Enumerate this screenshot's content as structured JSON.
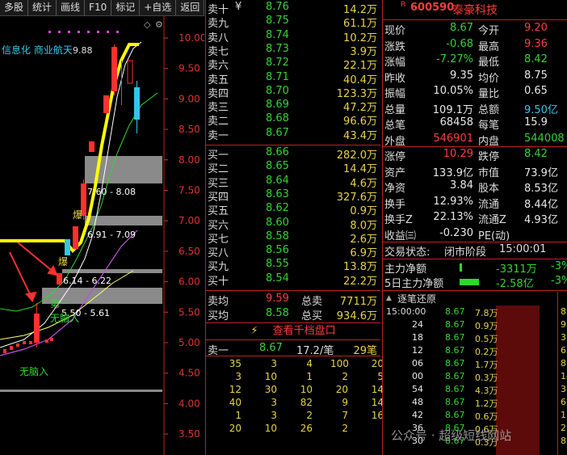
{
  "toolbar": [
    "多股",
    "统计",
    "画线",
    "F10",
    "标记",
    "+自选",
    "返回"
  ],
  "chart": {
    "axis_ticks": [
      "10.00",
      "9.50",
      "9.00",
      "8.50",
      "8.00",
      "7.50",
      "7.00",
      "6.50",
      "6.00",
      "5.50",
      "5.00",
      "4.50",
      "4.00",
      "3.50"
    ],
    "tag_text": "信息化 商业航天",
    "annotations": {
      "high": "9.88",
      "zone1": "7.60 - 8.08",
      "zone2": "6.91 - 7.09",
      "zone3": "6.14 - 6.22",
      "zone4": "5.50 - 5.61",
      "explode": "爆",
      "n1": "第一",
      "n2": "无脑入",
      "n3": "无脑入"
    },
    "colors": {
      "up": "#ff3030",
      "down": "#30c8e8",
      "ma_yellow": "#ffff00",
      "ma_white": "#ffffff",
      "ma_green": "#2ed82e",
      "ma_magenta": "#c050e0"
    }
  },
  "book": {
    "sell": [
      {
        "label": "卖十",
        "price": "8.76",
        "vol": "14.2万"
      },
      {
        "label": "卖九",
        "price": "8.75",
        "vol": "61.1万"
      },
      {
        "label": "卖八",
        "price": "8.74",
        "vol": "10.2万"
      },
      {
        "label": "卖七",
        "price": "8.73",
        "vol": "3.9万"
      },
      {
        "label": "卖六",
        "price": "8.72",
        "vol": "22.1万"
      },
      {
        "label": "卖五",
        "price": "8.71",
        "vol": "40.4万"
      },
      {
        "label": "卖四",
        "price": "8.70",
        "vol": "123.3万"
      },
      {
        "label": "卖三",
        "price": "8.69",
        "vol": "47.2万"
      },
      {
        "label": "卖二",
        "price": "8.68",
        "vol": "96.6万"
      },
      {
        "label": "卖一",
        "price": "8.67",
        "vol": "43.4万"
      }
    ],
    "sell_top_marks": "¥",
    "buy": [
      {
        "label": "买一",
        "price": "8.66",
        "vol": "282.0万"
      },
      {
        "label": "买二",
        "price": "8.65",
        "vol": "14.4万"
      },
      {
        "label": "买三",
        "price": "8.64",
        "vol": "4.6万"
      },
      {
        "label": "买四",
        "price": "8.63",
        "vol": "327.6万"
      },
      {
        "label": "买五",
        "price": "8.62",
        "vol": "0.9万"
      },
      {
        "label": "买六",
        "price": "8.60",
        "vol": "8.0万"
      },
      {
        "label": "买七",
        "price": "8.58",
        "vol": "2.6万"
      },
      {
        "label": "买八",
        "price": "8.56",
        "vol": "6.9万"
      },
      {
        "label": "买九",
        "price": "8.55",
        "vol": "13.8万"
      },
      {
        "label": "买十",
        "price": "8.54",
        "vol": "22.2万"
      }
    ],
    "avg_sell": {
      "label": "卖均",
      "price": "9.59",
      "total_label": "总卖",
      "total": "7711万"
    },
    "avg_buy": {
      "label": "买均",
      "price": "8.58",
      "total_label": "总买",
      "total": "934.6万"
    },
    "view_button": "查看千档盘口",
    "sell1_detail": {
      "label": "卖一",
      "price": "8.67",
      "avg": "17.2/笔",
      "count": "29笔"
    },
    "queue": [
      [
        "35",
        "3",
        "4",
        "100",
        "20"
      ],
      [
        "3",
        "10",
        "1",
        "2",
        "5"
      ],
      [
        "12",
        "30",
        "10",
        "20",
        "14"
      ],
      [
        "40",
        "3",
        "82",
        "9",
        "14"
      ],
      [
        "1",
        "3",
        "2",
        "7",
        "16"
      ],
      [
        "20",
        "10",
        "26",
        "2",
        ""
      ]
    ]
  },
  "info": {
    "code": "600590",
    "name": "泰豪科技",
    "rows": [
      {
        "a": "现价",
        "av": "8.67",
        "b": "今开",
        "bv": "9.20"
      },
      {
        "a": "涨跌",
        "av": "-0.68",
        "b": "最高",
        "bv": "9.36"
      },
      {
        "a": "涨幅",
        "av": "-7.27%",
        "b": "最低",
        "bv": "8.42"
      },
      {
        "a": "昨收",
        "av": "9.35",
        "b": "均价",
        "bv": "8.75"
      },
      {
        "a": "振幅",
        "av": "10.05%",
        "b": "量比",
        "bv": "0.65"
      },
      {
        "a": "总量",
        "av": "109.1万",
        "b": "总额",
        "bv": "9.50亿"
      },
      {
        "a": "总笔",
        "av": "68458",
        "b": "每笔",
        "bv": "15.9"
      },
      {
        "a": "外盘",
        "av": "546901",
        "b": "内盘",
        "bv": "544008"
      }
    ],
    "rows2": [
      {
        "a": "涨停",
        "av": "10.29",
        "b": "跌停",
        "bv": "8.42"
      },
      {
        "a": "资产",
        "av": "133.9亿",
        "b": "市值",
        "bv": "73.9亿"
      },
      {
        "a": "净资",
        "av": "3.84",
        "b": "股本",
        "bv": "8.53亿"
      },
      {
        "a": "换手",
        "av": "12.93%",
        "b": "流通",
        "bv": "8.44亿"
      },
      {
        "a": "换手Z",
        "av": "22.13%",
        "b": "流通Z",
        "bv": "4.93亿"
      },
      {
        "a": "收益㈢",
        "av": "-0.230",
        "b": "PE(动)",
        "bv": ""
      }
    ],
    "trade_status_label": "交易状态:",
    "trade_status": "闭市阶段",
    "trade_time": "15:00:01",
    "main_flow": {
      "label": "主力净额",
      "value": "-3311万",
      "pct": "-3%"
    },
    "main_flow5": {
      "label": "5日主力净额",
      "value": "-2.58亿",
      "pct": "-3%"
    },
    "ticks_title": "逐笔还原",
    "ticks_first_time": "15:00:00",
    "ticks": [
      {
        "t": "",
        "p": "8.67",
        "v": "7.8万"
      },
      {
        "t": "24",
        "p": "8.67",
        "v": "0.9万"
      },
      {
        "t": "18",
        "p": "8.67",
        "v": "0.5万"
      },
      {
        "t": "12",
        "p": "8.67",
        "v": "0.2万"
      },
      {
        "t": "06",
        "p": "8.67",
        "v": "1.7万"
      },
      {
        "t": "00",
        "p": "8.67",
        "v": "0.3万"
      },
      {
        "t": "54",
        "p": "8.67",
        "v": "4.3万"
      },
      {
        "t": "48",
        "p": "8.67",
        "v": "1.2万"
      },
      {
        "t": "42",
        "p": "8.67",
        "v": "0.6万"
      },
      {
        "t": "36",
        "p": "8.67",
        "v": "0.6万"
      },
      {
        "t": "30",
        "p": "8.67",
        "v": "0.3万"
      }
    ],
    "right_col": [
      "89",
      "9",
      "3",
      "6",
      "8",
      "14",
      "3",
      "6",
      "11",
      "2",
      "8"
    ],
    "watermark": "公众号 · 超级短线网站"
  }
}
